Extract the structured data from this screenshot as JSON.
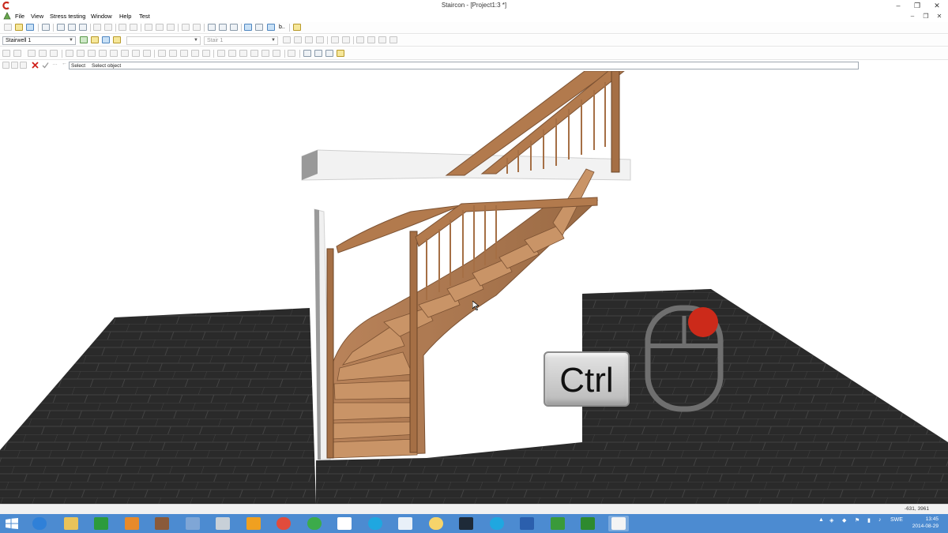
{
  "window": {
    "title": "Staircon - [Project1:3 *]",
    "minimize_label": "–",
    "restore_label": "❐",
    "close_label": "✕"
  },
  "menu": {
    "items": [
      "File",
      "View",
      "Stress testing",
      "Window",
      "Help",
      "Test"
    ],
    "mdi_minimize": "–",
    "mdi_restore": "❐",
    "mdi_close": "✕"
  },
  "toolbar": {
    "stairwell_select": "Stairwell 1",
    "stair_select": "Stair 1",
    "b_button_label": "b.."
  },
  "command_line": {
    "label": "Select",
    "prompt": "Select object"
  },
  "overlay": {
    "key_label": "Ctrl",
    "mouse_button": "right",
    "accent_color": "#cc2a1a"
  },
  "status": {
    "coords": "-631, 3961"
  },
  "taskbar": {
    "apps": [
      "internet-explorer",
      "file-explorer",
      "store",
      "outlook",
      "game",
      "library",
      "notepad",
      "network",
      "chrome",
      "ie-e",
      "dropbox",
      "skype",
      "teamviewer",
      "app-yellow",
      "terminal",
      "skype-2",
      "word",
      "camtasia-1",
      "camtasia-2",
      "staircon"
    ],
    "language": "SWE",
    "time": "13:45",
    "date": "2014-08-29"
  }
}
